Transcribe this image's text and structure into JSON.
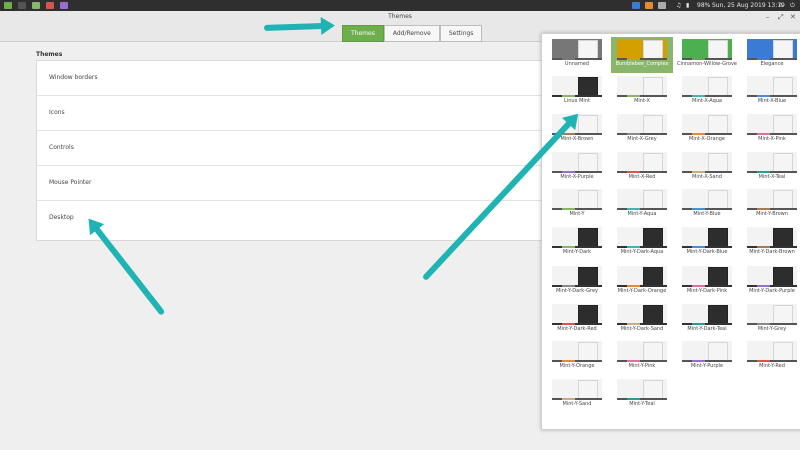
{
  "taskbar": {
    "battery": "98%",
    "clock": "Sun, 25 Aug 2019 13:19"
  },
  "window": {
    "title": "Themes",
    "tabs": [
      {
        "label": "Themes",
        "active": true
      },
      {
        "label": "Add/Remove",
        "active": false
      },
      {
        "label": "Settings",
        "active": false
      }
    ],
    "section_title": "Themes",
    "rows": [
      {
        "label": "Window borders"
      },
      {
        "label": "Icons"
      },
      {
        "label": "Controls"
      },
      {
        "label": "Mouse Pointer"
      },
      {
        "label": "Desktop"
      }
    ]
  },
  "popup": {
    "themes": [
      {
        "name": "Unnamed",
        "style": "special",
        "accent": "#777777"
      },
      {
        "name": "Bumblebee_Complex",
        "style": "special",
        "accent": "#d4a000",
        "selected": true
      },
      {
        "name": "Cinnamon-Willow-Grove",
        "style": "special",
        "accent": "#4caf50"
      },
      {
        "name": "Elegance",
        "style": "special",
        "accent": "#3a7bd5"
      },
      {
        "name": "Linux Mint",
        "style": "dark",
        "accent": "#8ab66a"
      },
      {
        "name": "Mint-X",
        "style": "light",
        "accent": "#8ab66a"
      },
      {
        "name": "Mint-X-Aqua",
        "style": "light",
        "accent": "#3fb6b0"
      },
      {
        "name": "Mint-X-Blue",
        "style": "light",
        "accent": "#4a8dd8"
      },
      {
        "name": "Mint-X-Brown",
        "style": "light",
        "accent": "#a97b50"
      },
      {
        "name": "Mint-X-Grey",
        "style": "light",
        "accent": "#888888"
      },
      {
        "name": "Mint-X-Orange",
        "style": "light",
        "accent": "#e68a2e"
      },
      {
        "name": "Mint-X-Pink",
        "style": "light",
        "accent": "#e06fa0"
      },
      {
        "name": "Mint-X-Purple",
        "style": "light",
        "accent": "#9a6ccf"
      },
      {
        "name": "Mint-X-Red",
        "style": "light",
        "accent": "#d9534f"
      },
      {
        "name": "Mint-X-Sand",
        "style": "light",
        "accent": "#c8ad7f"
      },
      {
        "name": "Mint-X-Teal",
        "style": "light",
        "accent": "#2a9d8f"
      },
      {
        "name": "Mint-Y",
        "style": "light",
        "accent": "#8ab66a"
      },
      {
        "name": "Mint-Y-Aqua",
        "style": "light",
        "accent": "#3fb6b0"
      },
      {
        "name": "Mint-Y-Blue",
        "style": "light",
        "accent": "#4a8dd8"
      },
      {
        "name": "Mint-Y-Brown",
        "style": "light",
        "accent": "#a97b50"
      },
      {
        "name": "Mint-Y-Dark",
        "style": "dark",
        "accent": "#8ab66a"
      },
      {
        "name": "Mint-Y-Dark-Aqua",
        "style": "dark",
        "accent": "#3fb6b0"
      },
      {
        "name": "Mint-Y-Dark-Blue",
        "style": "dark",
        "accent": "#4a8dd8"
      },
      {
        "name": "Mint-Y-Dark-Brown",
        "style": "dark",
        "accent": "#a97b50"
      },
      {
        "name": "Mint-Y-Dark-Grey",
        "style": "dark",
        "accent": "#888888"
      },
      {
        "name": "Mint-Y-Dark-Orange",
        "style": "dark",
        "accent": "#e68a2e"
      },
      {
        "name": "Mint-Y-Dark-Pink",
        "style": "dark",
        "accent": "#e06fa0"
      },
      {
        "name": "Mint-Y-Dark-Purple",
        "style": "dark",
        "accent": "#9a6ccf"
      },
      {
        "name": "Mint-Y-Dark-Red",
        "style": "dark",
        "accent": "#d9534f"
      },
      {
        "name": "Mint-Y-Dark-Sand",
        "style": "dark",
        "accent": "#c8ad7f"
      },
      {
        "name": "Mint-Y-Dark-Teal",
        "style": "dark",
        "accent": "#2a9d8f"
      },
      {
        "name": "Mint-Y-Grey",
        "style": "light",
        "accent": "#888888"
      },
      {
        "name": "Mint-Y-Orange",
        "style": "light",
        "accent": "#e68a2e"
      },
      {
        "name": "Mint-Y-Pink",
        "style": "light",
        "accent": "#e06fa0"
      },
      {
        "name": "Mint-Y-Purple",
        "style": "light",
        "accent": "#9a6ccf"
      },
      {
        "name": "Mint-Y-Red",
        "style": "light",
        "accent": "#d9534f"
      },
      {
        "name": "Mint-Y-Sand",
        "style": "light",
        "accent": "#c8ad7f"
      },
      {
        "name": "Mint-Y-Teal",
        "style": "light",
        "accent": "#2a9d8f"
      }
    ]
  },
  "colors": {
    "accent_green": "#6fae4c",
    "annotation_arrow": "#20b3b3",
    "taskbar_bg": "#2f2f2f"
  }
}
